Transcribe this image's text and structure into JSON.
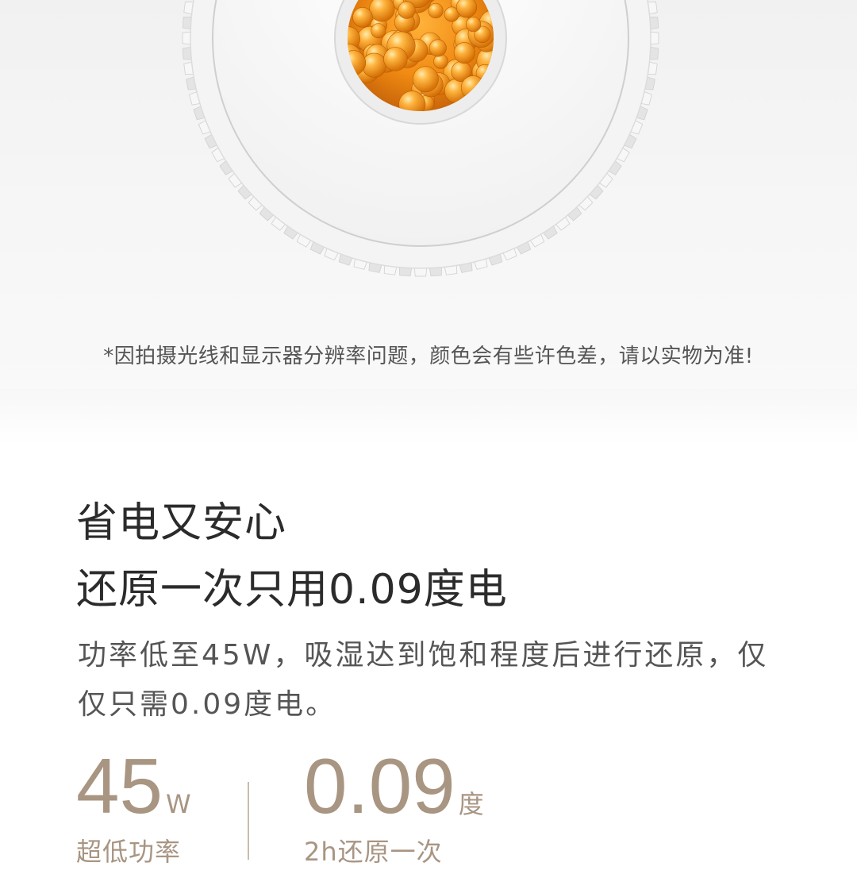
{
  "hero": {
    "image": "product-topview-dehumidifier-silica-gel",
    "disclaimer": "*因拍摄光线和显示器分辨率问题，颜色会有些许色差，请以实物为准!"
  },
  "feature": {
    "title_line1": "省电又安心",
    "title_line2": "还原一次只用0.09度电",
    "description": "功率低至45W，吸湿达到饱和程度后进行还原，仅仅只需0.09度电。"
  },
  "stats": [
    {
      "value": "45",
      "unit": "W",
      "caption": "超低功率"
    },
    {
      "value": "0.09",
      "unit": "度",
      "caption": "2h还原一次"
    }
  ],
  "colors": {
    "accent": "#a89582",
    "title": "#2b2b2b",
    "body": "#555555"
  }
}
